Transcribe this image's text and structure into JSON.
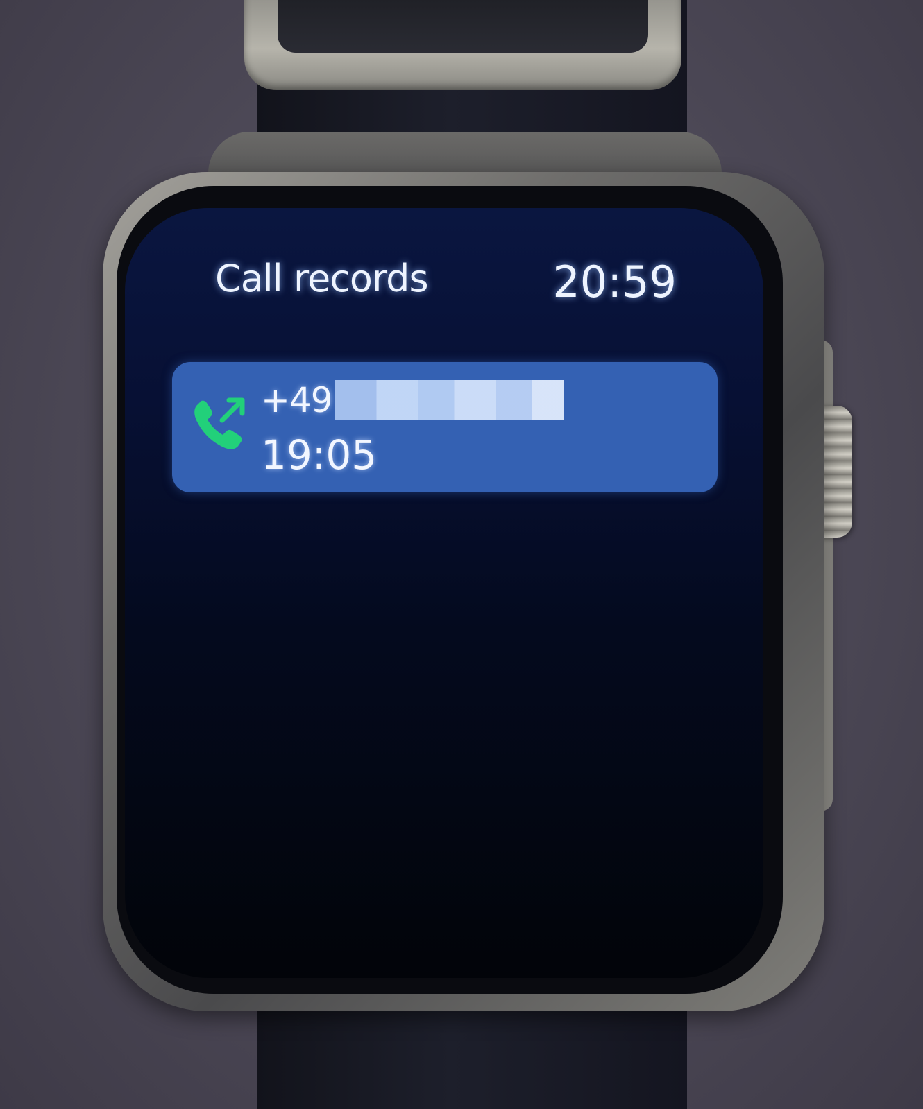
{
  "header": {
    "title": "Call records",
    "clock": "20:59"
  },
  "records": [
    {
      "icon": "outgoing-call-icon",
      "number_prefix": "+49",
      "number_redacted": true,
      "time": "19:05"
    }
  ],
  "colors": {
    "screen_background": "#06102e",
    "record_background": "#3461b3",
    "call_icon": "#22d07a",
    "text": "#eef4ff"
  }
}
